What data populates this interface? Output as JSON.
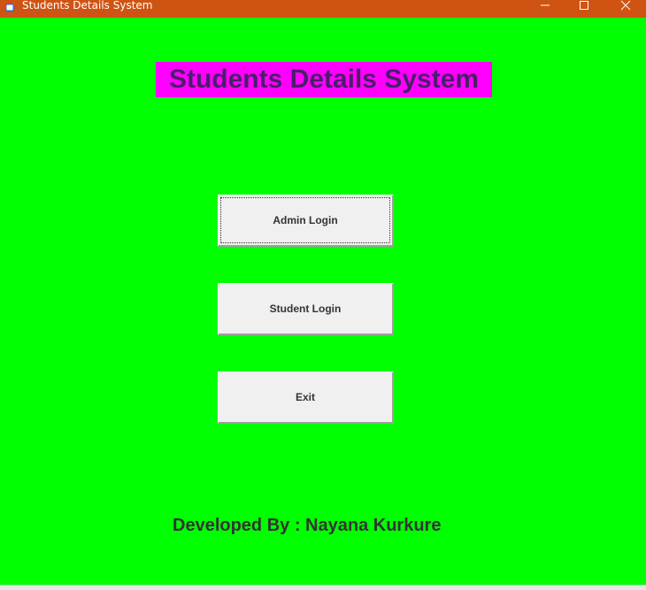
{
  "window": {
    "title": "Students Details System",
    "titlebar_color": "#cf5413",
    "background_color": "#00ff00"
  },
  "heading": {
    "text": "Students Details System",
    "background_color": "#ff00ff"
  },
  "buttons": {
    "admin_login": "Admin Login",
    "student_login": "Student Login",
    "exit": "Exit"
  },
  "footer": {
    "text": "Developed By : Nayana Kurkure"
  },
  "icons": {
    "app": "java-cup-icon",
    "minimize": "minimize-icon",
    "maximize": "maximize-icon",
    "close": "close-icon"
  }
}
